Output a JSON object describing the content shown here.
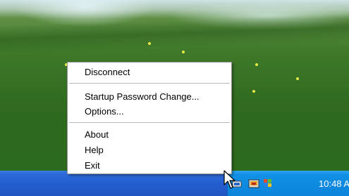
{
  "context_menu": {
    "items": [
      {
        "label": "Disconnect"
      },
      {
        "label": "Startup Password Change..."
      },
      {
        "label": "Options..."
      },
      {
        "label": "About"
      },
      {
        "label": "Help"
      },
      {
        "label": "Exit"
      }
    ]
  },
  "taskbar": {
    "clock": "10:48 A",
    "tray_icons": [
      "network-tray-icon",
      "app-tray-icon",
      "windows-tray-icon"
    ]
  },
  "colors": {
    "taskbar": "#245ed0",
    "tray": "#0c83da",
    "menu_bg": "#ffffff"
  }
}
